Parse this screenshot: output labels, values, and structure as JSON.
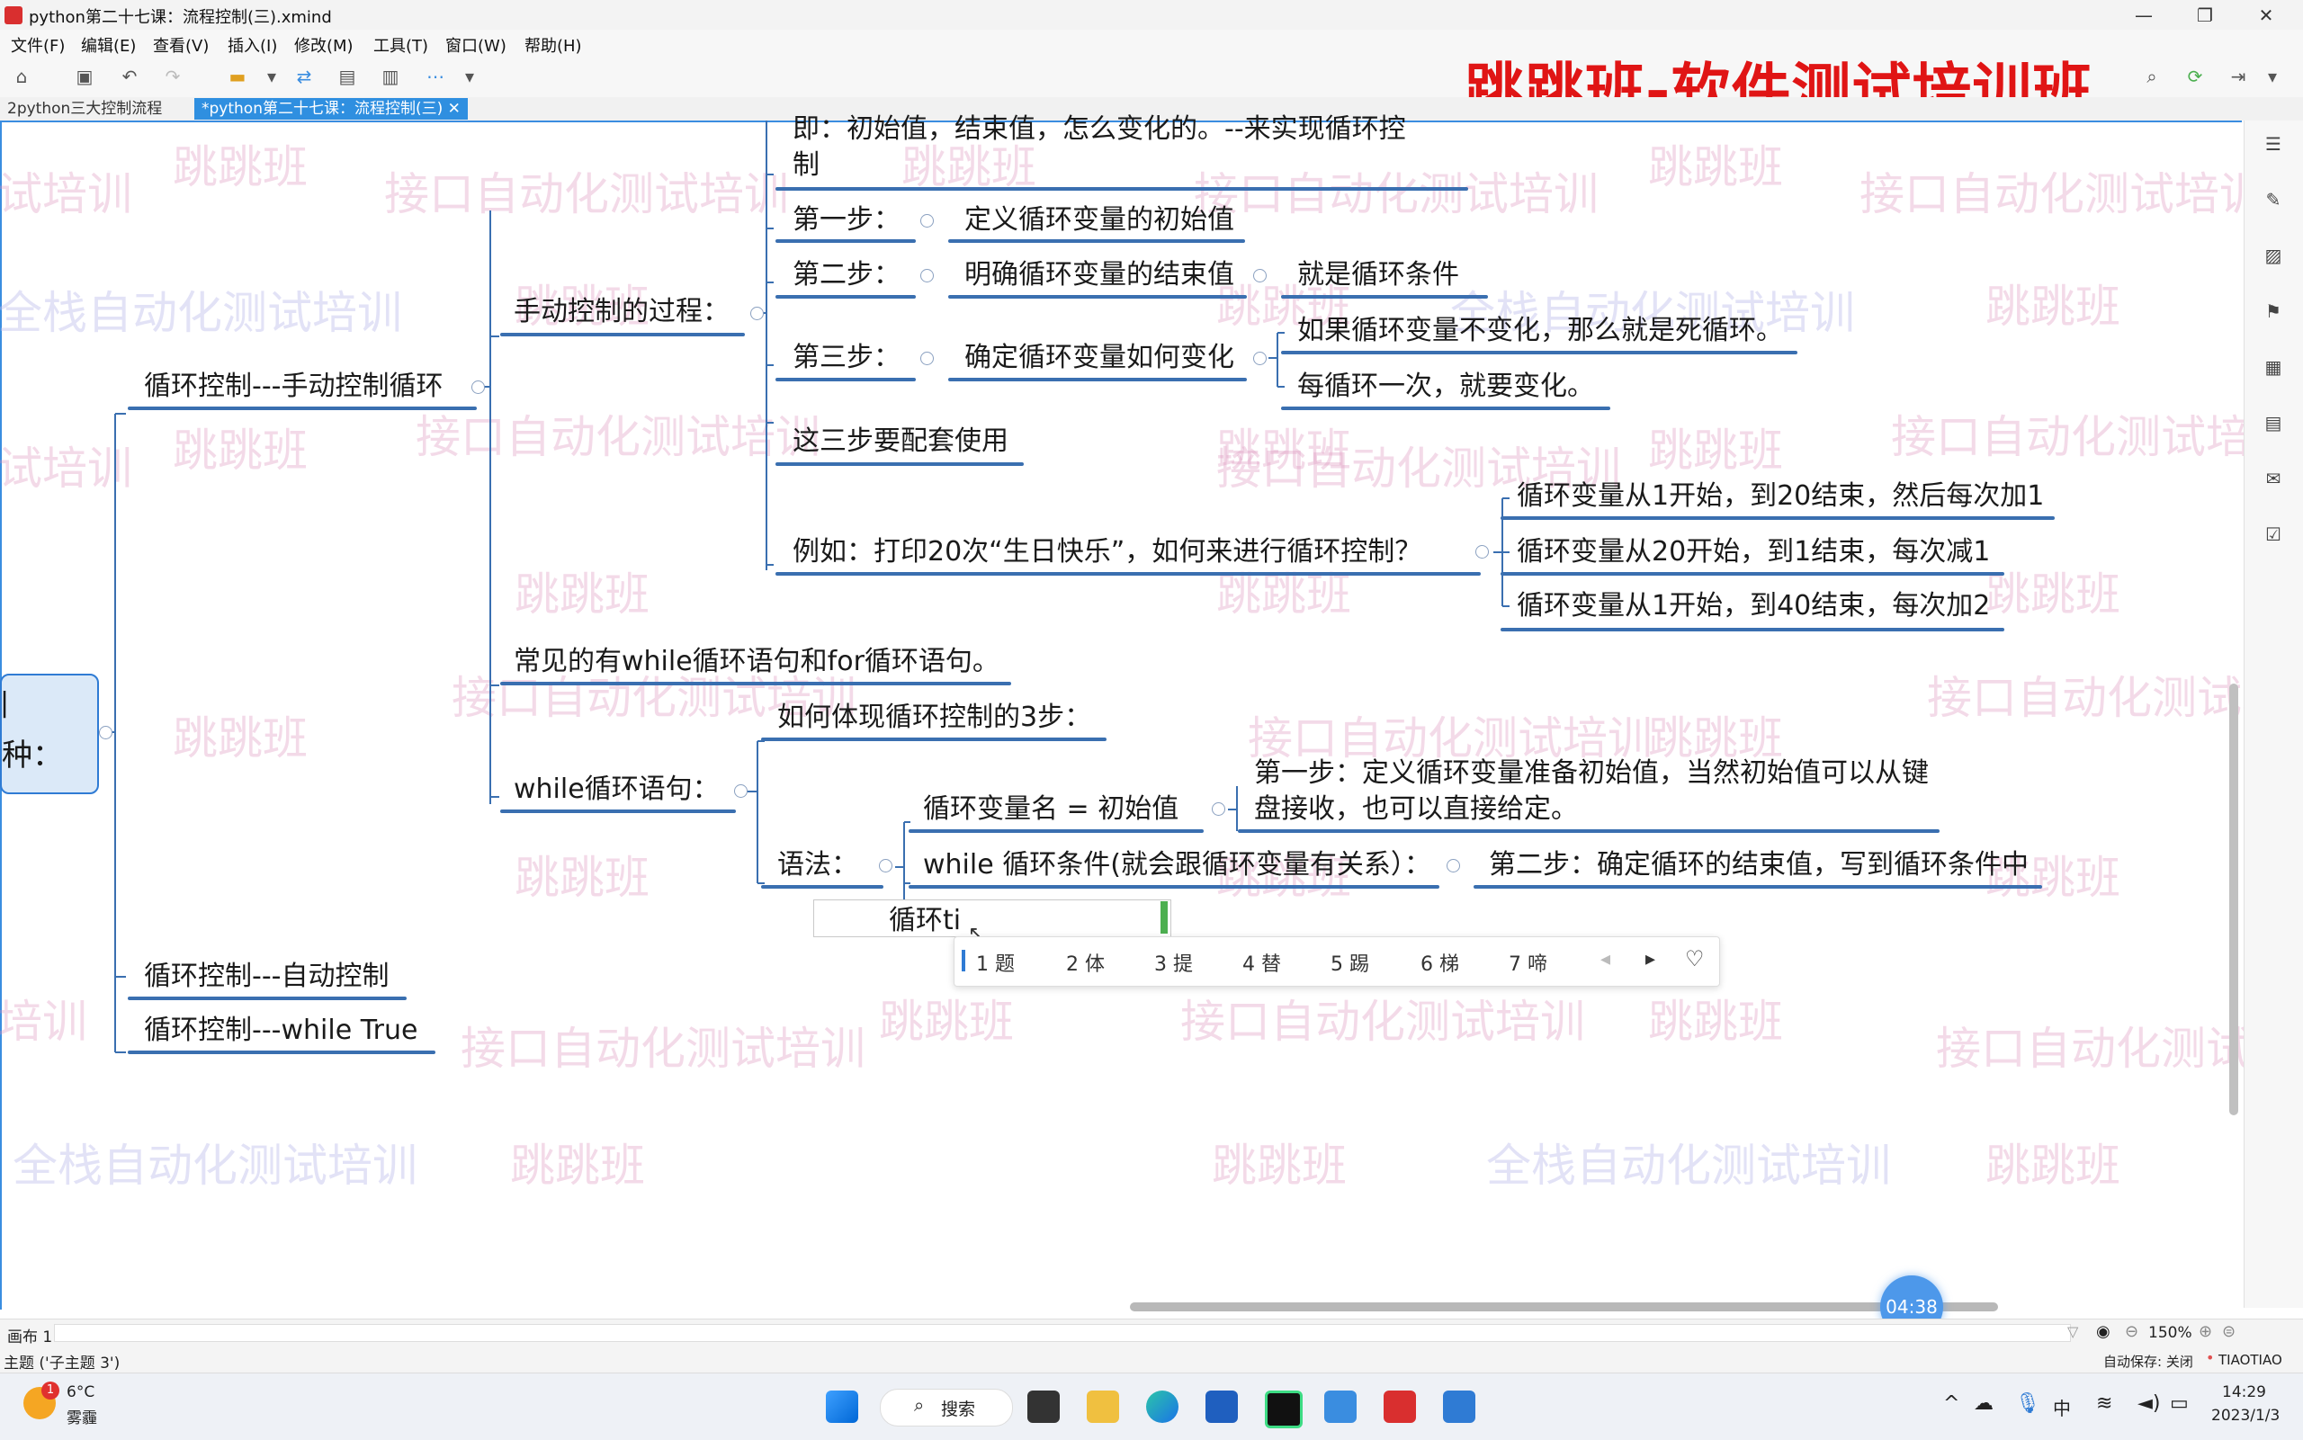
{
  "window": {
    "title": "python第二十七课：流程控制(三).xmind",
    "minimize": "—",
    "maximize": "❐",
    "close": "✕"
  },
  "menu": [
    "文件(F)",
    "编辑(E)",
    "查看(V)",
    "插入(I)",
    "修改(M)",
    "工具(T)",
    "窗口(W)",
    "帮助(H)"
  ],
  "banner": "跳跳班-软件测试培训班",
  "tabs": [
    {
      "label": "2python三大控制流程"
    },
    {
      "label": "*python第二十七课：流程控制(三) ✕"
    }
  ],
  "watermarks": {
    "brand": "跳跳班",
    "api": "接口自动化测试培训",
    "fullstack": "全栈自动化测试培训",
    "partial_train": "试培训",
    "partial_train2": "培训",
    "api_partial": "接口自动化测试培",
    "api_partial2": "接口自动化测试",
    "fullstack_partial": "全栈自动化测试培训"
  },
  "mindmap": {
    "root_label_top": "|",
    "root_label": "种：",
    "topics": {
      "manual": "循环控制---手动控制循环",
      "auto": "循环控制---自动控制",
      "while_true": "循环控制---while True"
    },
    "manual_children": {
      "process": "手动控制的过程：",
      "common": "常见的有while循环语句和for循环语句。",
      "while_stmt": "while循环语句："
    },
    "process_children": {
      "intro_line1": "即：初始值，结束值，怎么变化的。--来实现循环控",
      "intro_line2": "制",
      "step1": "第一步：",
      "step1_detail": "定义循环变量的初始值",
      "step2": "第二步：",
      "step2_detail": "明确循环变量的结束值",
      "step2_note": "就是循环条件",
      "step3": "第三步：",
      "step3_detail": "确定循环变量如何变化",
      "step3_note1": "如果循环变量不变化，那么就是死循环。",
      "step3_note2": "每循环一次，就要变化。",
      "together": "这三步要配套使用",
      "example": "例如：打印20次“生日快乐”，如何来进行循环控制？",
      "ex1": "循环变量从1开始，到20结束，然后每次加1",
      "ex2": "循环变量从20开始，到1结束，每次减1",
      "ex3": "循环变量从1开始，到40结束，每次加2"
    },
    "while_children": {
      "how": "如何体现循环控制的3步：",
      "syntax": "语法：",
      "init": "循环变量名 = 初始值",
      "init_note_line1": "第一步：定义循环变量准备初始值，当然初始值可以从键",
      "init_note_line2": "盘接收，也可以直接给定。",
      "cond": "while  循环条件(就会跟循环变量有关系）：",
      "cond_note": "第二步：确定循环的结束值，写到循环条件中"
    },
    "editing_text": "循环ti"
  },
  "ime": {
    "candidates": [
      "1 题",
      "2 体",
      "3 提",
      "4 替",
      "5 踢",
      "6 梯",
      "7 啼"
    ],
    "prev": "◂",
    "next": "▸"
  },
  "timer": "04:38",
  "sheet": {
    "name": "画布 1",
    "zoom": "150%"
  },
  "status": {
    "left": "主题 ('子主题 3')",
    "autosave": "自动保存: 关闭",
    "user": "TIAOTIAO"
  },
  "taskbar": {
    "weather_temp": "6°C",
    "weather_desc": "雾霾",
    "weather_badge": "1",
    "search": "搜索",
    "ime_lang": "中",
    "time": "14:29",
    "date": "2023/1/3"
  },
  "colors": {
    "accent": "#3a8de0",
    "banner_red": "#e01515",
    "node_underline": "#3a6fb0"
  }
}
